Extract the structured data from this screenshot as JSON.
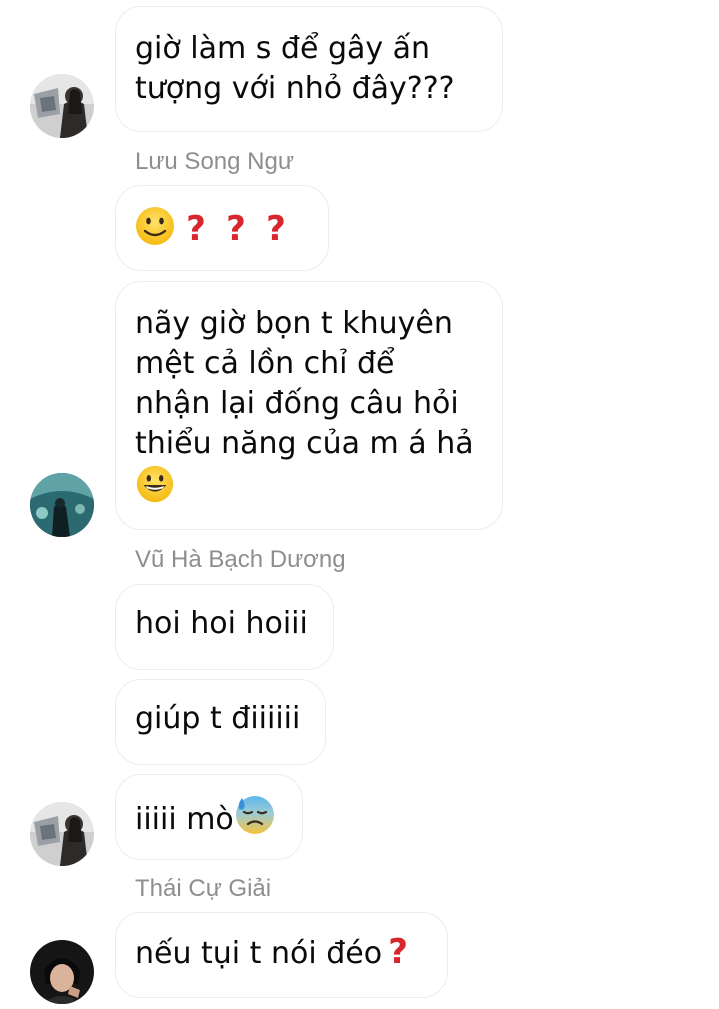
{
  "messages": [
    {
      "lines": [
        "giờ làm s để gây ấn",
        "tượng với nhỏ đây???"
      ]
    },
    {
      "sender": "Lưu Song Ngư",
      "emoji": [
        "slightly-smiling-face",
        "question-mark",
        "question-mark",
        "question-mark"
      ]
    },
    {
      "lines": [
        "nãy giờ bọn t khuyên",
        "mệt cả lồn chỉ để",
        "nhận lại đống câu hỏi",
        "thiểu năng của m á hả"
      ],
      "emoji": "grinning-face"
    },
    {
      "sender": "Vũ Hà Bạch Dương",
      "text": "hoi hoi hoiii"
    },
    {
      "text": "giúp t điiiiii"
    },
    {
      "text": "iiiii mò",
      "emoji": "anxious-face-with-sweat"
    },
    {
      "sender": "Thái Cự Giải",
      "text": "nếu tụi t nói đéo",
      "emoji": "question-mark"
    }
  ],
  "colors": {
    "sender_name": "#8e8e8e",
    "bubble_border": "#ececec",
    "text": "#0a0a0a",
    "question_mark": "#d9252c"
  }
}
